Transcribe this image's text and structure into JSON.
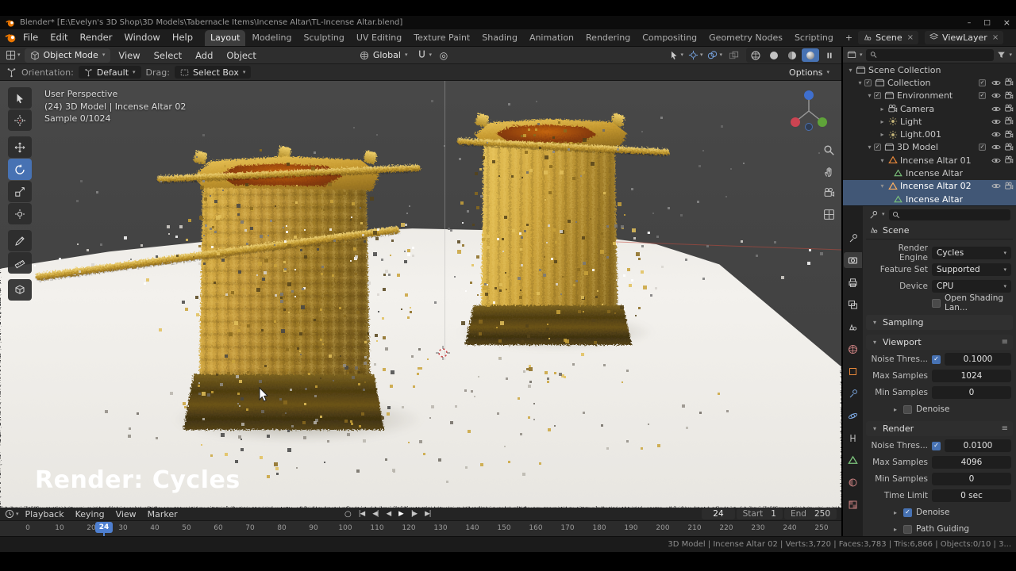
{
  "window": {
    "title": "Blender* [E:\\Evelyn's 3D Shop\\3D Models\\Tabernacle Items\\Incense Altar\\TL-Incense Altar.blend]"
  },
  "icons": {
    "caret_down": "▾",
    "caret_right": "▸",
    "check": "✓",
    "hamburger": "≡",
    "record": "○",
    "proportional": "◎",
    "minimize": "–",
    "maximize": "□",
    "close": "×",
    "plus": "+",
    "unlink": "×",
    "transport": [
      "|◀",
      "◀|",
      "◀",
      "▶",
      "|▶",
      "▶|"
    ]
  },
  "topbar": {
    "menus": [
      "File",
      "Edit",
      "Render",
      "Window",
      "Help"
    ],
    "tabs": [
      "Layout",
      "Modeling",
      "Sculpting",
      "UV Editing",
      "Texture Paint",
      "Shading",
      "Animation",
      "Rendering",
      "Compositing",
      "Geometry Nodes",
      "Scripting"
    ],
    "scene_label": "Scene",
    "view_layer_label": "ViewLayer"
  },
  "viewport_header": {
    "mode": "Object Mode",
    "menus": [
      "View",
      "Select",
      "Add",
      "Object"
    ],
    "orientation": "Global"
  },
  "tool_settings": {
    "orientation_label": "Orientation:",
    "orientation_value": "Default",
    "drag_label": "Drag:",
    "drag_value": "Select Box",
    "options_label": "Options"
  },
  "viewport": {
    "view_label": "User Perspective",
    "context_label": "(24) 3D Model | Incense Altar 02",
    "sample_label": "Sample 0/1024",
    "watermark": "Render: Cycles"
  },
  "outliner": {
    "search_placeholder": "",
    "rows": [
      {
        "label": "Scene Collection"
      },
      {
        "label": "Collection"
      },
      {
        "label": "Environment"
      },
      {
        "label": "Camera"
      },
      {
        "label": "Light"
      },
      {
        "label": "Light.001"
      },
      {
        "label": "3D Model"
      },
      {
        "label": "Incense Altar 01"
      },
      {
        "label": "Incense Altar"
      },
      {
        "label": "Incense Altar 02"
      },
      {
        "label": "Incense Altar"
      }
    ]
  },
  "properties": {
    "breadcrumb": "Scene",
    "render_engine_label": "Render Engine",
    "render_engine_value": "Cycles",
    "feature_set_label": "Feature Set",
    "feature_set_value": "Supported",
    "device_label": "Device",
    "device_value": "CPU",
    "osl_label": "Open Shading Lan...",
    "sampling_title": "Sampling",
    "viewport_title": "Viewport",
    "vp_noise_label": "Noise Thres...",
    "vp_noise_value": "0.1000",
    "vp_max_label": "Max Samples",
    "vp_max_value": "1024",
    "vp_min_label": "Min Samples",
    "vp_min_value": "0",
    "vp_denoise_label": "Denoise",
    "render_title": "Render",
    "r_noise_label": "Noise Thres...",
    "r_noise_value": "0.0100",
    "r_max_label": "Max Samples",
    "r_max_value": "4096",
    "r_min_label": "Min Samples",
    "r_min_value": "0",
    "r_time_label": "Time Limit",
    "r_time_value": "0 sec",
    "r_denoise_label": "Denoise",
    "path_guiding_label": "Path Guiding"
  },
  "timeline": {
    "menus": [
      "Playback",
      "Keying",
      "View",
      "Marker"
    ],
    "frame_value": "24",
    "start_label": "Start",
    "start_value": "1",
    "end_label": "End",
    "end_value": "250",
    "playhead": "24",
    "ticks": [
      "0",
      "10",
      "20",
      "30",
      "40",
      "50",
      "60",
      "70",
      "80",
      "90",
      "100",
      "110",
      "120",
      "130",
      "140",
      "150",
      "160",
      "170",
      "180",
      "190",
      "200",
      "210",
      "220",
      "230",
      "240",
      "250"
    ]
  },
  "statusbar": {
    "stats": "3D Model | Incense Altar 02 | Verts:3,720 | Faces:3,783 | Tris:6,866 | Objects:0/10 | 3..."
  }
}
